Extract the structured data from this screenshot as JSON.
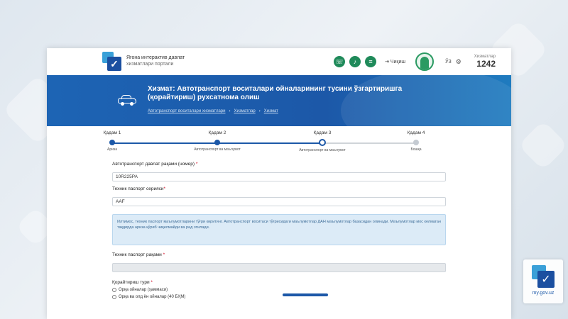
{
  "header": {
    "brand_line1": "Ягона интерактив давлат",
    "brand_line2": "хизматлари портали",
    "exit_label": "Чиқиш",
    "lang_label": "ЎЗ",
    "counter_label": "Хизматлар",
    "counter_value": "1242",
    "icons": [
      "phone-icon",
      "bell-icon",
      "menu-icon",
      "exit-icon",
      "user-icon",
      "notification-icon"
    ]
  },
  "banner": {
    "title": "Хизмат: Автотранспорт воситалари ойналарининг тусини ўзгартиришга (қорайтириш) рухсатнома олиш",
    "breadcrumbs": [
      "Автотранспорт воситалари хизматлари",
      "Хизматлар",
      "Хизмат"
    ]
  },
  "steps": [
    {
      "name": "Қадам 1",
      "desc": "Ариза",
      "state": "done"
    },
    {
      "name": "Қадам 2",
      "desc": "Автотранспорт ва маълумот",
      "state": "done"
    },
    {
      "name": "Қадам 3",
      "desc": "Автотранспорт ва маълумот",
      "state": "active"
    },
    {
      "name": "Қадам 4",
      "desc": "Бошқа",
      "state": "todo"
    }
  ],
  "form": {
    "plate_label": "Автотранспорт давлат рақами (номер)",
    "plate_value": "10R225PA",
    "passport_series_label": "Техник паспорт серияси",
    "passport_series_value": "AAF",
    "info_text": "Илтимос, техник паспорт маълумотларини тўғри киритинг. Автотранспорт воситаси тўғрисидаги маълумотлар ДАН маълумотлар базасидан олинади. Маълумотлар мос келмаган тақдирда ариза кўриб чиқилмайди ва рад этилади.",
    "passport_number_label": "Техник паспорт рақами",
    "passport_number_value": "",
    "tint_type_label": "Қорайтириш тури",
    "tint_options": [
      "Орқа ойналар (ҳаммаси)",
      "Орқа ва олд ён ойналар (40 БҲМ)"
    ]
  },
  "watermark": {
    "text": "my.gov.uz"
  },
  "colors": {
    "banner": "#1c58a8",
    "accent_green": "#1f8a5a",
    "info_bg": "#dcebf7"
  }
}
